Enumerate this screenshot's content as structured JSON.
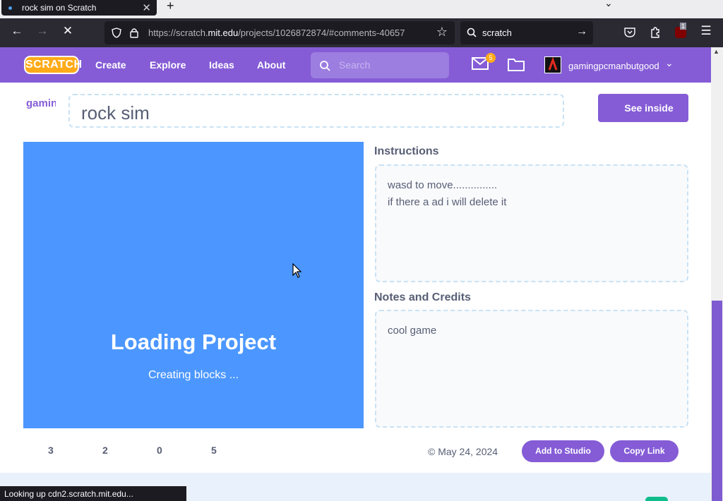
{
  "browser": {
    "tab_title": "rock sim on Scratch",
    "url_host": "https://scratch.",
    "url_domain": "mit.edu",
    "url_path": "/projects/1026872874/#comments-40657",
    "search_text": "scratch",
    "status_text": "Looking up cdn2.scratch.mit.edu..."
  },
  "nav": {
    "logo": "SCRATCH",
    "links": [
      "Create",
      "Explore",
      "Ideas",
      "About"
    ],
    "search_placeholder": "Search",
    "message_count": "5",
    "username": "gamingpcmanbutgood"
  },
  "project": {
    "owner": "gaming",
    "title": "rock sim",
    "see_inside": "See inside",
    "loading_title": "Loading Project",
    "loading_sub": "Creating blocks ...",
    "instructions_head": "Instructions",
    "instructions": [
      "wasd to move...............",
      "if there a ad i will delete it"
    ],
    "notes_head": "Notes and Credits",
    "notes": "cool game",
    "stats": [
      "3",
      "2",
      "0",
      "5"
    ],
    "date": "May 24, 2024",
    "add_to_studio": "Add to Studio",
    "copy_link": "Copy Link"
  },
  "colors": {
    "scratch_purple": "#855cd6",
    "stage_blue": "#4c97ff",
    "logo_orange": "#ffab19"
  }
}
